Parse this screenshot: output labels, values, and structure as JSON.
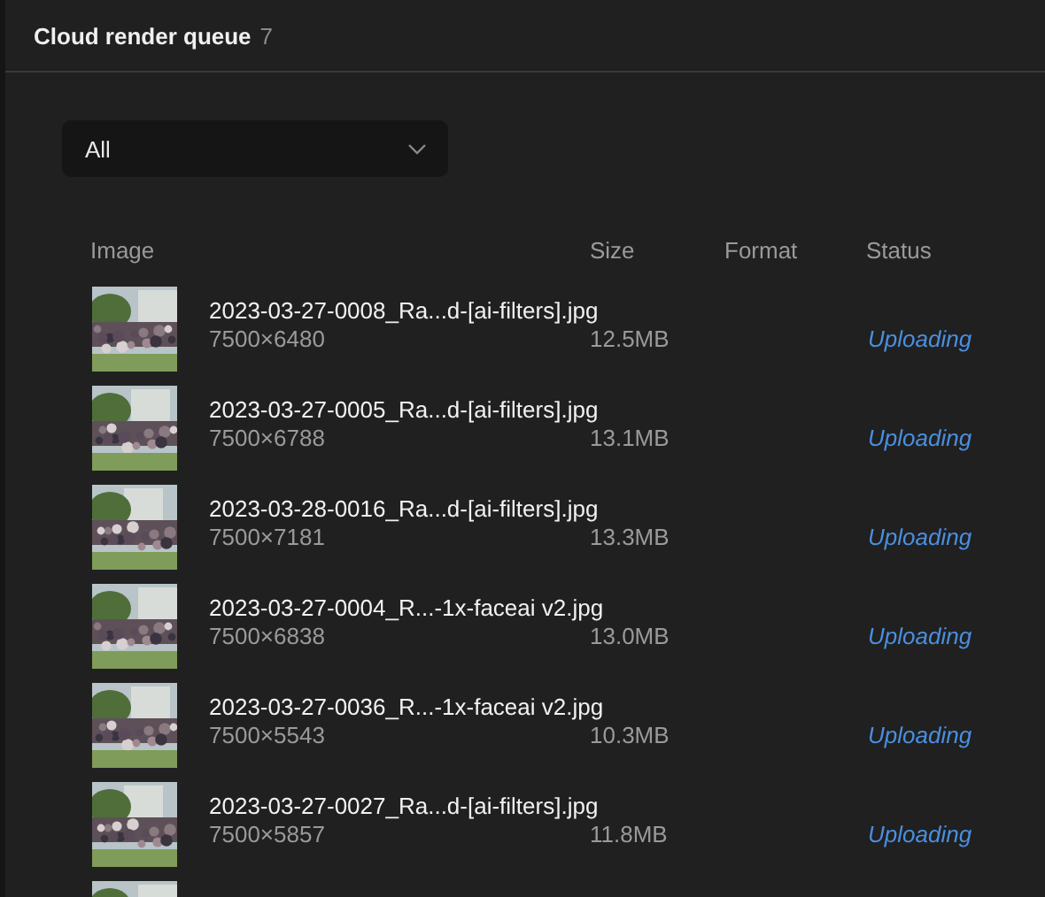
{
  "header": {
    "title": "Cloud render queue",
    "count": "7"
  },
  "filter": {
    "value": "All"
  },
  "table": {
    "columns": [
      "Image",
      "Size",
      "Format",
      "Status"
    ],
    "rows": [
      {
        "kind": "file",
        "name": "2023-03-27-0008_Ra...d-[ai-filters].jpg",
        "dimensions": "7500×6480",
        "size": "12.5MB",
        "status": "Uploading"
      },
      {
        "kind": "file",
        "name": "2023-03-27-0005_Ra...d-[ai-filters].jpg",
        "dimensions": "7500×6788",
        "size": "13.1MB",
        "status": "Uploading"
      },
      {
        "kind": "file",
        "name": "2023-03-28-0016_Ra...d-[ai-filters].jpg",
        "dimensions": "7500×7181",
        "size": "13.3MB",
        "status": "Uploading"
      },
      {
        "kind": "file",
        "name": "2023-03-27-0004_R...-1x-faceai v2.jpg",
        "dimensions": "7500×6838",
        "size": "13.0MB",
        "status": "Uploading"
      },
      {
        "kind": "file",
        "name": "2023-03-27-0036_R...-1x-faceai v2.jpg",
        "dimensions": "7500×5543",
        "size": "10.3MB",
        "status": "Uploading"
      },
      {
        "kind": "file",
        "name": "2023-03-27-0027_Ra...d-[ai-filters].jpg",
        "dimensions": "7500×5857",
        "size": "11.8MB",
        "status": "Uploading"
      },
      {
        "kind": "picture"
      }
    ]
  }
}
